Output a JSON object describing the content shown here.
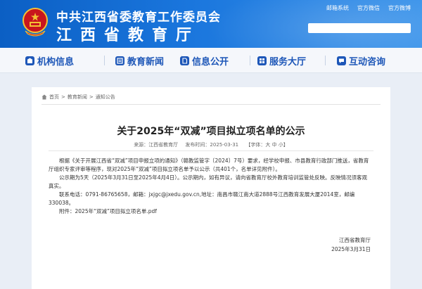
{
  "header": {
    "org_line1": "中共江西省委教育工作委员会",
    "org_line2": "江西省教育厅",
    "top_links": [
      "邮箱系统",
      "官方微信",
      "官方微博"
    ],
    "colors": {
      "primary": "#0b5fc4",
      "emblem_red": "#c8161d",
      "emblem_gold": "#f3c234"
    }
  },
  "nav": {
    "items": [
      {
        "label": "机构信息",
        "icon": "building-icon"
      },
      {
        "label": "教育新闻",
        "icon": "news-icon"
      },
      {
        "label": "信息公开",
        "icon": "document-icon"
      },
      {
        "label": "服务大厅",
        "icon": "service-icon"
      },
      {
        "label": "互动咨询",
        "icon": "chat-icon"
      }
    ]
  },
  "breadcrumb": {
    "items": [
      "首页",
      "教育新闻",
      "通知公告"
    ],
    "separator": ">"
  },
  "article": {
    "title": "关于2025年“双减”项目拟立项名单的公示",
    "source_label": "来源：",
    "source": "江西省教育厅",
    "date_label": "发布时间：",
    "date": "2025-03-31",
    "font_size_label": "【字体：大 中 小】",
    "paragraph1": "根据《关于开展江西省“双减”项目申报立项的通知》（赣教监管字〔2024〕7号）要求，经学校申报、市县教育行政部门推送，省教育厅组织专家评审等程序，现对2025年“双减”项目拟立项名单予以公示（共401个，名单详见附件）。",
    "paragraph2": "公示期为5天（2025年3月31日至2025年4月4日）。公示期内，如有异议，请向省教育厅校外教育培训监管处反映。反映情况须客观真实。",
    "paragraph3": "联系电话：0791-86765658，邮箱：jxjgc@jxedu.gov.cn,地址：南昌市赣江南大道2888号江西教育发展大厦2014室，邮编330038。",
    "attachment": "附件：2025年“双减”项目拟立项名单.pdf",
    "sign_org": "江西省教育厅",
    "sign_date": "2025年3月31日"
  }
}
